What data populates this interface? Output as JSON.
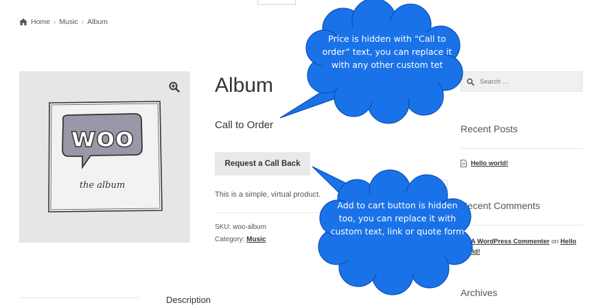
{
  "breadcrumb": {
    "home": "Home",
    "sep": "›",
    "music": "Music",
    "current": "Album"
  },
  "product": {
    "image_text_main": "woo",
    "image_text_sub": "the album",
    "title": "Album",
    "price_text": "Call to Order",
    "button_label": "Request a Call Back",
    "description": "This is a simple, virtual product.",
    "sku_label": "SKU:",
    "sku": "woo-album",
    "category_label": "Category:",
    "category": "Music"
  },
  "sidebar": {
    "search_placeholder": "Search …",
    "recent_posts_title": "Recent Posts",
    "post_title": "Hello world!",
    "recent_comments_title": "Recent Comments",
    "comment_author": "A WordPress Commenter",
    "comment_on": "on",
    "comment_post": "Hello world!",
    "archives_title": "Archives"
  },
  "bottom": {
    "text": "Description"
  },
  "callouts": {
    "price_note": "Price is hidden with “Call to order” text, you can replace it with any other custom tet",
    "button_note": "Add to cart button is hidden too, you can replace it with custom text, link or quote form",
    "color": "#1a72e8"
  }
}
